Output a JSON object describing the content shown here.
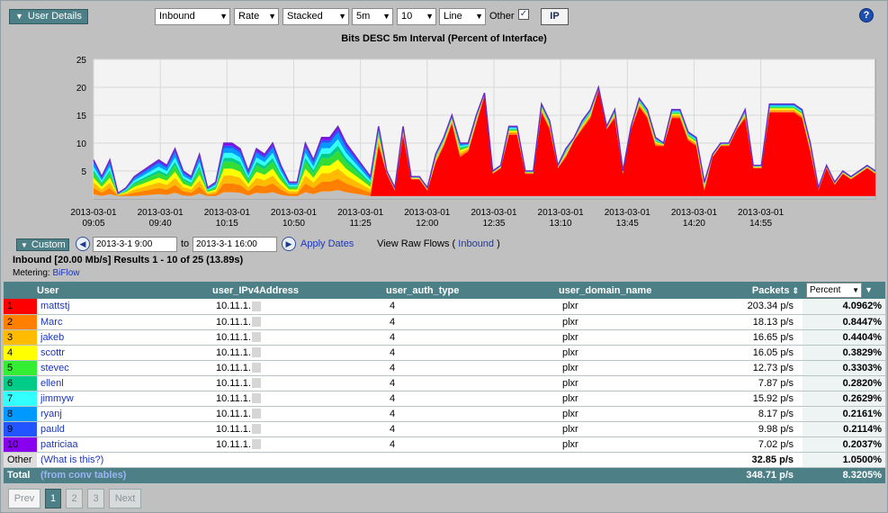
{
  "toolbar": {
    "section_label": "User Details",
    "selects": [
      {
        "value": "Inbound"
      },
      {
        "value": "Rate"
      },
      {
        "value": "Stacked"
      },
      {
        "value": "5m"
      },
      {
        "value": "10"
      },
      {
        "value": "Line"
      }
    ],
    "other_label": "Other",
    "other_checked": "✓",
    "ip_button": "IP",
    "help_glyph": "?"
  },
  "chart_data": {
    "type": "area",
    "title": "Bits DESC 5m Interval (Percent of Interface)",
    "ylim": [
      0,
      25
    ],
    "yticks": [
      "25",
      "20",
      "15",
      "10",
      "5"
    ],
    "xtick_labels": [
      {
        "date": "2013-03-01",
        "time": "09:05"
      },
      {
        "date": "2013-03-01",
        "time": "09:40"
      },
      {
        "date": "2013-03-01",
        "time": "10:15"
      },
      {
        "date": "2013-03-01",
        "time": "10:50"
      },
      {
        "date": "2013-03-01",
        "time": "11:25"
      },
      {
        "date": "2013-03-01",
        "time": "12:00"
      },
      {
        "date": "2013-03-01",
        "time": "12:35"
      },
      {
        "date": "2013-03-01",
        "time": "13:10"
      },
      {
        "date": "2013-03-01",
        "time": "13:45"
      },
      {
        "date": "2013-03-01",
        "time": "14:20"
      },
      {
        "date": "2013-03-01",
        "time": "14:55"
      }
    ],
    "grid": true,
    "total": [
      7,
      4,
      7,
      1,
      2,
      4,
      5,
      6,
      7,
      6,
      9,
      5,
      4,
      8,
      2,
      3,
      10,
      10,
      9,
      5,
      9,
      8,
      10,
      6,
      3,
      3,
      10,
      7,
      11,
      11,
      13,
      10,
      8,
      6,
      4,
      13,
      5,
      2,
      13,
      4,
      4,
      2,
      8,
      11,
      15,
      10,
      10,
      15,
      19,
      5,
      6,
      13,
      13,
      5,
      5,
      17,
      14,
      6,
      9,
      11,
      14,
      16,
      20,
      13,
      16,
      5,
      13,
      18,
      16,
      11,
      10,
      16,
      16,
      12,
      11,
      3,
      8,
      10,
      10,
      13,
      16,
      6,
      6,
      17,
      17,
      17,
      17,
      16,
      10,
      2,
      6,
      3,
      5,
      4,
      5,
      6,
      5
    ],
    "red": [
      0,
      0,
      0,
      0,
      0,
      0,
      0,
      0,
      0,
      0,
      0,
      0,
      0,
      0,
      0,
      0,
      0,
      0,
      0,
      0,
      0,
      0,
      0,
      0,
      0,
      0,
      0,
      0,
      0,
      0,
      0,
      0,
      0,
      0,
      0,
      9,
      4,
      1,
      11,
      3,
      3,
      1,
      6,
      9,
      13,
      7,
      8,
      13,
      18,
      4,
      5,
      11,
      11,
      4,
      4,
      15,
      12,
      5,
      7,
      10,
      12,
      14,
      19,
      12,
      14,
      4,
      12,
      16,
      14,
      9,
      9,
      14,
      14,
      10,
      9,
      1,
      7,
      9,
      9,
      12,
      14,
      5,
      5,
      15,
      15,
      15,
      15,
      14,
      8,
      1,
      5,
      2,
      4,
      3,
      4,
      5,
      4
    ],
    "series": [
      {
        "color": "#ff0000"
      },
      {
        "color": "#ff8000"
      },
      {
        "color": "#ffbb00"
      },
      {
        "color": "#ffff00"
      },
      {
        "color": "#33dd33"
      },
      {
        "color": "#00cc88"
      },
      {
        "color": "#33ffff"
      },
      {
        "color": "#0099ff"
      },
      {
        "color": "#2255ff"
      },
      {
        "color": "#8800ee"
      }
    ],
    "base_color": "#c0c0c0"
  },
  "date_range": {
    "custom_label": "Custom",
    "start": "2013-3-1 9:00",
    "to_label": "to",
    "end": "2013-3-1 16:00",
    "apply_label": "Apply Dates",
    "raw_flows_prefix": "View Raw Flows (",
    "raw_flows_link": "Inbound",
    "raw_flows_suffix": ")"
  },
  "summary": "Inbound [20.00 Mb/s] Results 1 - 10 of 25 (13.89s)",
  "metering": {
    "label": "Metering:",
    "link": "BiFlow"
  },
  "table": {
    "headers": {
      "user": "User",
      "ip": "user_IPv4Address",
      "auth": "user_auth_type",
      "domain": "user_domain_name",
      "packets": "Packets",
      "percent_select": "Percent"
    },
    "rows": [
      {
        "rank": "1",
        "color": "#ff0000",
        "user": "mattstj",
        "ip": "10.11.1.",
        "auth": "4",
        "domain": "plxr",
        "packets": "203.34 p/s",
        "percent": "4.0962%"
      },
      {
        "rank": "2",
        "color": "#ff8000",
        "user": "Marc",
        "ip": "10.11.1.",
        "auth": "4",
        "domain": "plxr",
        "packets": "18.13 p/s",
        "percent": "0.8447%"
      },
      {
        "rank": "3",
        "color": "#ffbb00",
        "user": "jakeb",
        "ip": "10.11.1.",
        "auth": "4",
        "domain": "plxr",
        "packets": "16.65 p/s",
        "percent": "0.4404%"
      },
      {
        "rank": "4",
        "color": "#ffff00",
        "user": "scottr",
        "ip": "10.11.1.",
        "auth": "4",
        "domain": "plxr",
        "packets": "16.05 p/s",
        "percent": "0.3829%"
      },
      {
        "rank": "5",
        "color": "#33ee33",
        "user": "stevec",
        "ip": "10.11.1.",
        "auth": "4",
        "domain": "plxr",
        "packets": "12.73 p/s",
        "percent": "0.3303%"
      },
      {
        "rank": "6",
        "color": "#00cc88",
        "user": "ellenl",
        "ip": "10.11.1.",
        "auth": "4",
        "domain": "plxr",
        "packets": "7.87 p/s",
        "percent": "0.2820%"
      },
      {
        "rank": "7",
        "color": "#33ffff",
        "user": "jimmyw",
        "ip": "10.11.1.",
        "auth": "4",
        "domain": "plxr",
        "packets": "15.92 p/s",
        "percent": "0.2629%"
      },
      {
        "rank": "8",
        "color": "#0099ff",
        "user": "ryanj",
        "ip": "10.11.1.",
        "auth": "4",
        "domain": "plxr",
        "packets": "8.17 p/s",
        "percent": "0.2161%"
      },
      {
        "rank": "9",
        "color": "#2255ff",
        "user": "pauld",
        "ip": "10.11.1.",
        "auth": "4",
        "domain": "plxr",
        "packets": "9.98 p/s",
        "percent": "0.2114%"
      },
      {
        "rank": "10",
        "color": "#8800ee",
        "user": "patriciaa",
        "ip": "10.11.1.",
        "auth": "4",
        "domain": "plxr",
        "packets": "7.02 p/s",
        "percent": "0.2037%"
      }
    ],
    "other": {
      "label": "Other",
      "link": "(What is this?)",
      "packets": "32.85 p/s",
      "percent": "1.0500%"
    },
    "total": {
      "label": "Total",
      "link": "(from conv tables)",
      "packets": "348.71 p/s",
      "percent": "8.3205%"
    }
  },
  "pager": {
    "prev": "Prev",
    "pages": [
      "1",
      "2",
      "3"
    ],
    "next": "Next"
  }
}
